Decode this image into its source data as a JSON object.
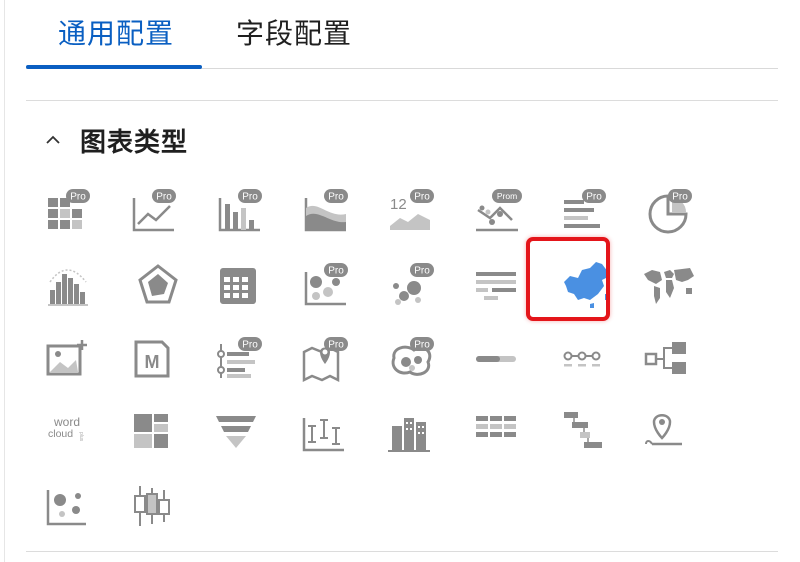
{
  "tabs": [
    {
      "label": "通用配置",
      "active": true
    },
    {
      "label": "字段配置",
      "active": false
    }
  ],
  "section": {
    "title": "图表类型",
    "expanded": true
  },
  "badge": "Pro",
  "badge_prom": "Prom",
  "word_cloud": {
    "line1": "word",
    "line2": "cloud",
    "line3": "plus"
  },
  "colors": {
    "accent": "#0a5fc2",
    "icon": "#8a8a8a",
    "icon_light": "#c4c4c4",
    "selected": "#4a90e2",
    "highlight_border": "#e4151a"
  },
  "chart_types": [
    {
      "icon": "pro-table-icon",
      "pro": true
    },
    {
      "icon": "pro-line-chart-icon",
      "pro": true
    },
    {
      "icon": "pro-bar-chart-icon",
      "pro": true
    },
    {
      "icon": "pro-area-chart-icon",
      "pro": true
    },
    {
      "icon": "pro-kpi-icon",
      "pro": true
    },
    {
      "icon": "prom-scatter-line-icon",
      "pro": true
    },
    {
      "icon": "pro-ranking-icon",
      "pro": true
    },
    {
      "icon": "pro-pie-chart-icon",
      "pro": true
    },
    {
      "icon": "histogram-icon",
      "pro": false
    },
    {
      "icon": "radar-chart-icon",
      "pro": false
    },
    {
      "icon": "pivot-table-icon",
      "pro": false
    },
    {
      "icon": "pro-bubble-chart-icon",
      "pro": true
    },
    {
      "icon": "pro-scatter-icon",
      "pro": true
    },
    {
      "icon": "crosstab-icon",
      "pro": false
    },
    {
      "icon": "china-map-icon",
      "pro": false,
      "selected": true
    },
    {
      "icon": "world-map-icon",
      "pro": false
    },
    {
      "icon": "image-chart-icon",
      "pro": false
    },
    {
      "icon": "markdown-icon",
      "pro": false
    },
    {
      "icon": "pro-timeline-icon",
      "pro": true
    },
    {
      "icon": "pro-geo-map-icon",
      "pro": true
    },
    {
      "icon": "pro-bubble-map-icon",
      "pro": true
    },
    {
      "icon": "progress-bar-icon",
      "pro": false
    },
    {
      "icon": "step-flow-icon",
      "pro": false
    },
    {
      "icon": "tree-diagram-icon",
      "pro": false
    },
    {
      "icon": "word-cloud-plus-icon",
      "pro": false
    },
    {
      "icon": "treemap-icon",
      "pro": false
    },
    {
      "icon": "funnel-icon",
      "pro": false
    },
    {
      "icon": "error-bar-icon",
      "pro": false
    },
    {
      "icon": "building-bar-icon",
      "pro": false
    },
    {
      "icon": "detail-table-icon",
      "pro": false
    },
    {
      "icon": "gantt-chart-icon",
      "pro": false
    },
    {
      "icon": "location-icon",
      "pro": false
    },
    {
      "icon": "cluster-scatter-icon",
      "pro": false
    },
    {
      "icon": "boxplot-icon",
      "pro": false
    }
  ]
}
